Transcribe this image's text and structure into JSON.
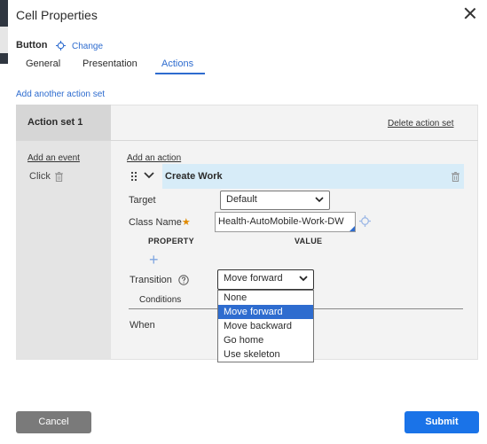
{
  "dialog": {
    "title": "Cell Properties"
  },
  "control": {
    "name": "Button",
    "change_label": "Change"
  },
  "tabs": [
    {
      "label": "General"
    },
    {
      "label": "Presentation"
    },
    {
      "label": "Actions"
    }
  ],
  "actions": {
    "add_action_set_label": "Add another action set",
    "action_set": {
      "title": "Action set 1",
      "delete_label": "Delete action set",
      "add_event_label": "Add an event",
      "event": "Click",
      "add_action_label": "Add an action",
      "action": {
        "title": "Create Work",
        "target_label": "Target",
        "target_value": "Default",
        "class_name_label": "Class Name",
        "class_name_required_mark": "★",
        "class_name_value": "Health-AutoMobile-Work-DW",
        "property_header": "PROPERTY",
        "value_header": "VALUE",
        "add_property_symbol": "+",
        "transition_label": "Transition",
        "transition_value": "Move forward",
        "transition_options": [
          "None",
          "Move forward",
          "Move backward",
          "Go home",
          "Use skeleton"
        ],
        "conditions_tab": "Conditions",
        "when_label": "When"
      }
    }
  },
  "footer": {
    "cancel_label": "Cancel",
    "submit_label": "Submit"
  },
  "colors": {
    "accent": "#2e6ccf",
    "primary_button": "#1a73e8",
    "secondary_button": "#7a7a7a",
    "action_row": "#d7ecf8"
  },
  "icons": [
    "close-icon",
    "target-icon",
    "trash-icon",
    "drag-handle-icon",
    "chevron-down-icon",
    "help-icon",
    "plus-icon"
  ]
}
